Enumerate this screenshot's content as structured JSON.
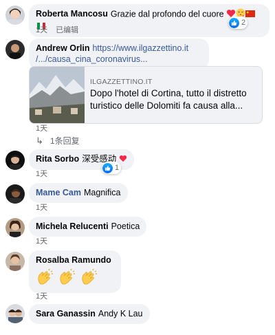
{
  "comments": [
    {
      "name": "Roberta Mancosu",
      "text": "Grazie dal profondo del cuore",
      "time": "1天",
      "edited": "已编辑",
      "likes": "2"
    },
    {
      "name": "Andrew Orlin",
      "url_line1": "https://www.ilgazzettino.it",
      "url_line2": "/.../causa_cina_coronavirus...",
      "link_domain": "ILGAZZETTINO.IT",
      "link_title": "Dopo l'hotel di Cortina, tutto il distretto turistico delle Dolomiti fa causa alla...",
      "time": "1天",
      "replies": "1条回复"
    },
    {
      "name": "Rita Sorbo",
      "text": "深受感动",
      "time": "1天",
      "likes": "1"
    },
    {
      "name": "Mame Cam",
      "text": "Magnifica",
      "time": "1天"
    },
    {
      "name": "Michela Relucenti",
      "text": "Poetica",
      "time": "1天"
    },
    {
      "name": "Rosalba Ramundo",
      "time": "1天"
    },
    {
      "name": "Sara Ganassin",
      "text": "Andy K Lau"
    }
  ],
  "colors": {
    "bubble": "#f0f2f5",
    "link_name": "#385898",
    "meta": "#65676b",
    "like_blue": "#0866ff",
    "heart": "#f02849"
  }
}
